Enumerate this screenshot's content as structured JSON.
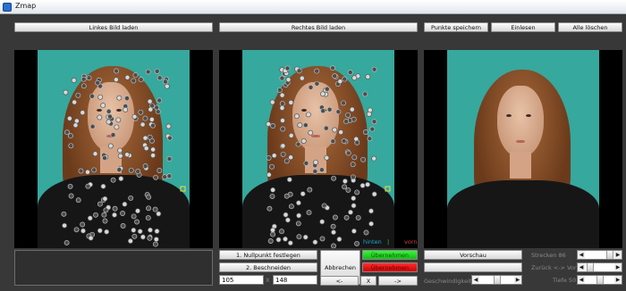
{
  "window": {
    "title": "Zmap"
  },
  "toolbar": {
    "left_load": "Linkes Bild laden",
    "right_load": "Rechtes Bild laden",
    "save_points": "Punkte speichern",
    "read_in": "Einlesen",
    "delete_all": "Alle löschen"
  },
  "controls": {
    "zero_point": "1. Nullpunkt festlegen",
    "crop": "2. Beschneiden",
    "x_value": "105",
    "x_sep": "X",
    "y_value": "148",
    "cancel": "Abbrechen",
    "apply_green": "Übernehmen",
    "apply_red": "Übernehmen",
    "nav_prev": "<-",
    "nav_close": "X",
    "nav_next": "->",
    "preview": "Vorschau",
    "speed_label": "Geschwindigkeit"
  },
  "indicators": {
    "hinten": "hinten",
    "vorn": "vorn",
    "sep": "|"
  },
  "sliders": {
    "stretch_label": "Strecken 86",
    "back_label": "Zurück <-> Vor 1",
    "depth_label": "Tiefe 50"
  },
  "colors": {
    "background": "#383838",
    "teal_backdrop": "#36a89d",
    "hinten": "#1fa7d6",
    "vorn": "#d94040",
    "apply_green": "#2ad62a",
    "apply_red": "#e81414"
  }
}
